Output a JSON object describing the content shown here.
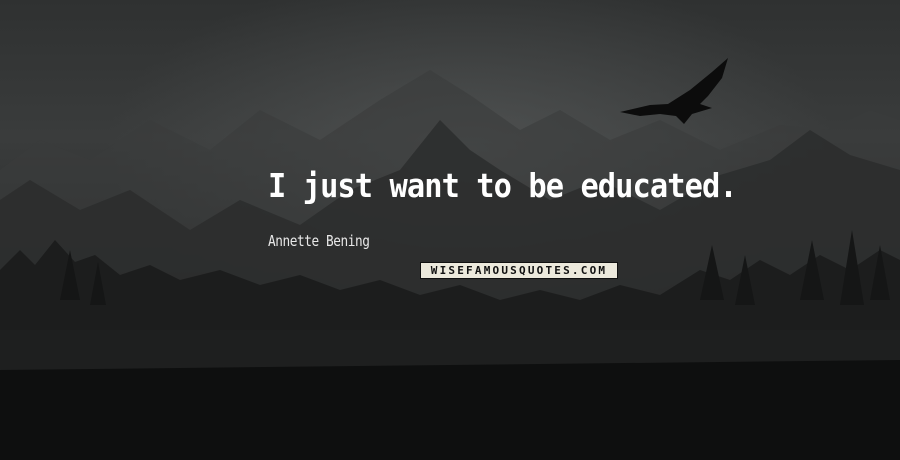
{
  "quote": {
    "text": "I just want to be educated.",
    "author": "Annette Bening"
  },
  "watermark": {
    "text": "WISEFAMOUSQUOTES.COM"
  },
  "icons": {
    "dragon": "dragon-silhouette-icon"
  },
  "colors": {
    "background": "#2a2b2b",
    "text": "#ffffff",
    "watermark_bg": "#ece9dc"
  }
}
